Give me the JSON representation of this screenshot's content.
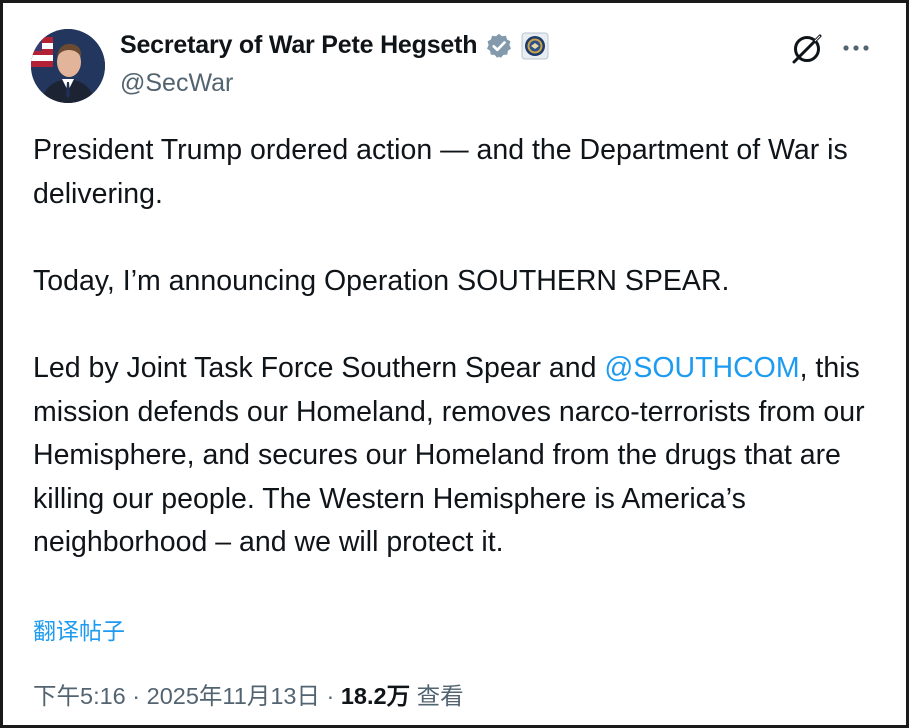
{
  "author": {
    "display_name": "Secretary of War Pete Hegseth",
    "handle": "@SecWar",
    "verified_color": "#829aab",
    "icons": [
      "verified-badge-icon",
      "organization-seal-icon"
    ]
  },
  "toolbar": {
    "icons": [
      "grok-icon",
      "more-options-icon"
    ]
  },
  "tweet": {
    "para1": "President Trump ordered action — and the Department of War is delivering.",
    "para2": "Today, I’m announcing Operation SOUTHERN SPEAR.",
    "para3_before_mention": "Led by Joint Task Force Southern Spear and ",
    "mention": "@SOUTHCOM",
    "para3_after_mention": ", this mission defends our Homeland, removes narco-terrorists from our Hemisphere, and secures our Homeland from the drugs that are killing our people. The Western Hemisphere is America’s neighborhood – and we will protect it."
  },
  "translate_label": "翻译帖子",
  "meta": {
    "time": "下午5:16",
    "separator": " · ",
    "date": "2025年11月13日",
    "views_count": "18.2万",
    "views_label": " 查看"
  },
  "colors": {
    "text": "#0f1419",
    "secondary": "#536471",
    "link": "#1d9bf0"
  }
}
